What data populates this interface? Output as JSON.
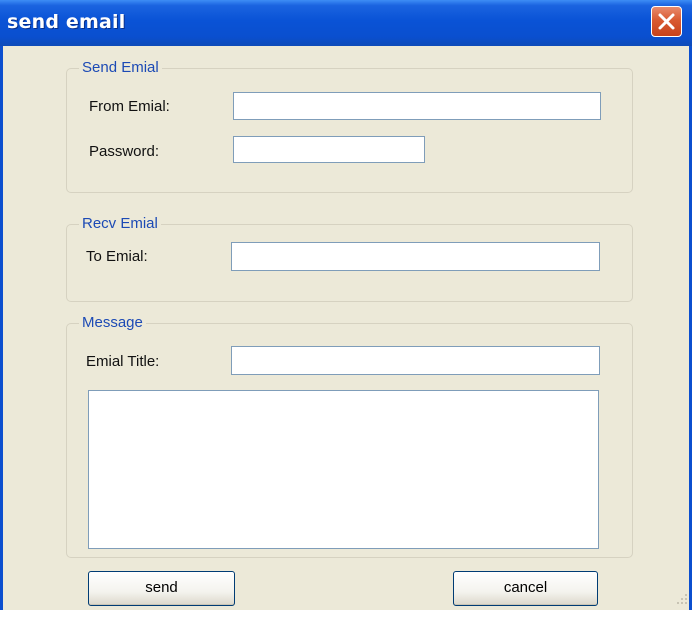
{
  "window": {
    "title": "send email"
  },
  "send_group": {
    "legend": "Send Emial",
    "from_label": "From Emial:",
    "from_value": "",
    "password_label": "Password:",
    "password_value": ""
  },
  "recv_group": {
    "legend": "Recv Emial",
    "to_label": "To Emial:",
    "to_value": ""
  },
  "message_group": {
    "legend": "Message",
    "title_label": "Emial Title:",
    "title_value": "",
    "body_value": ""
  },
  "buttons": {
    "send_label": "send",
    "cancel_label": "cancel"
  },
  "icons": {
    "close": "close-icon",
    "grip": "resize-grip-icon"
  },
  "colors": {
    "titlebar": "#0a53d6",
    "window_bg": "#ece9d8",
    "close_button": "#d95a32",
    "legend_text": "#1c4ab5"
  }
}
